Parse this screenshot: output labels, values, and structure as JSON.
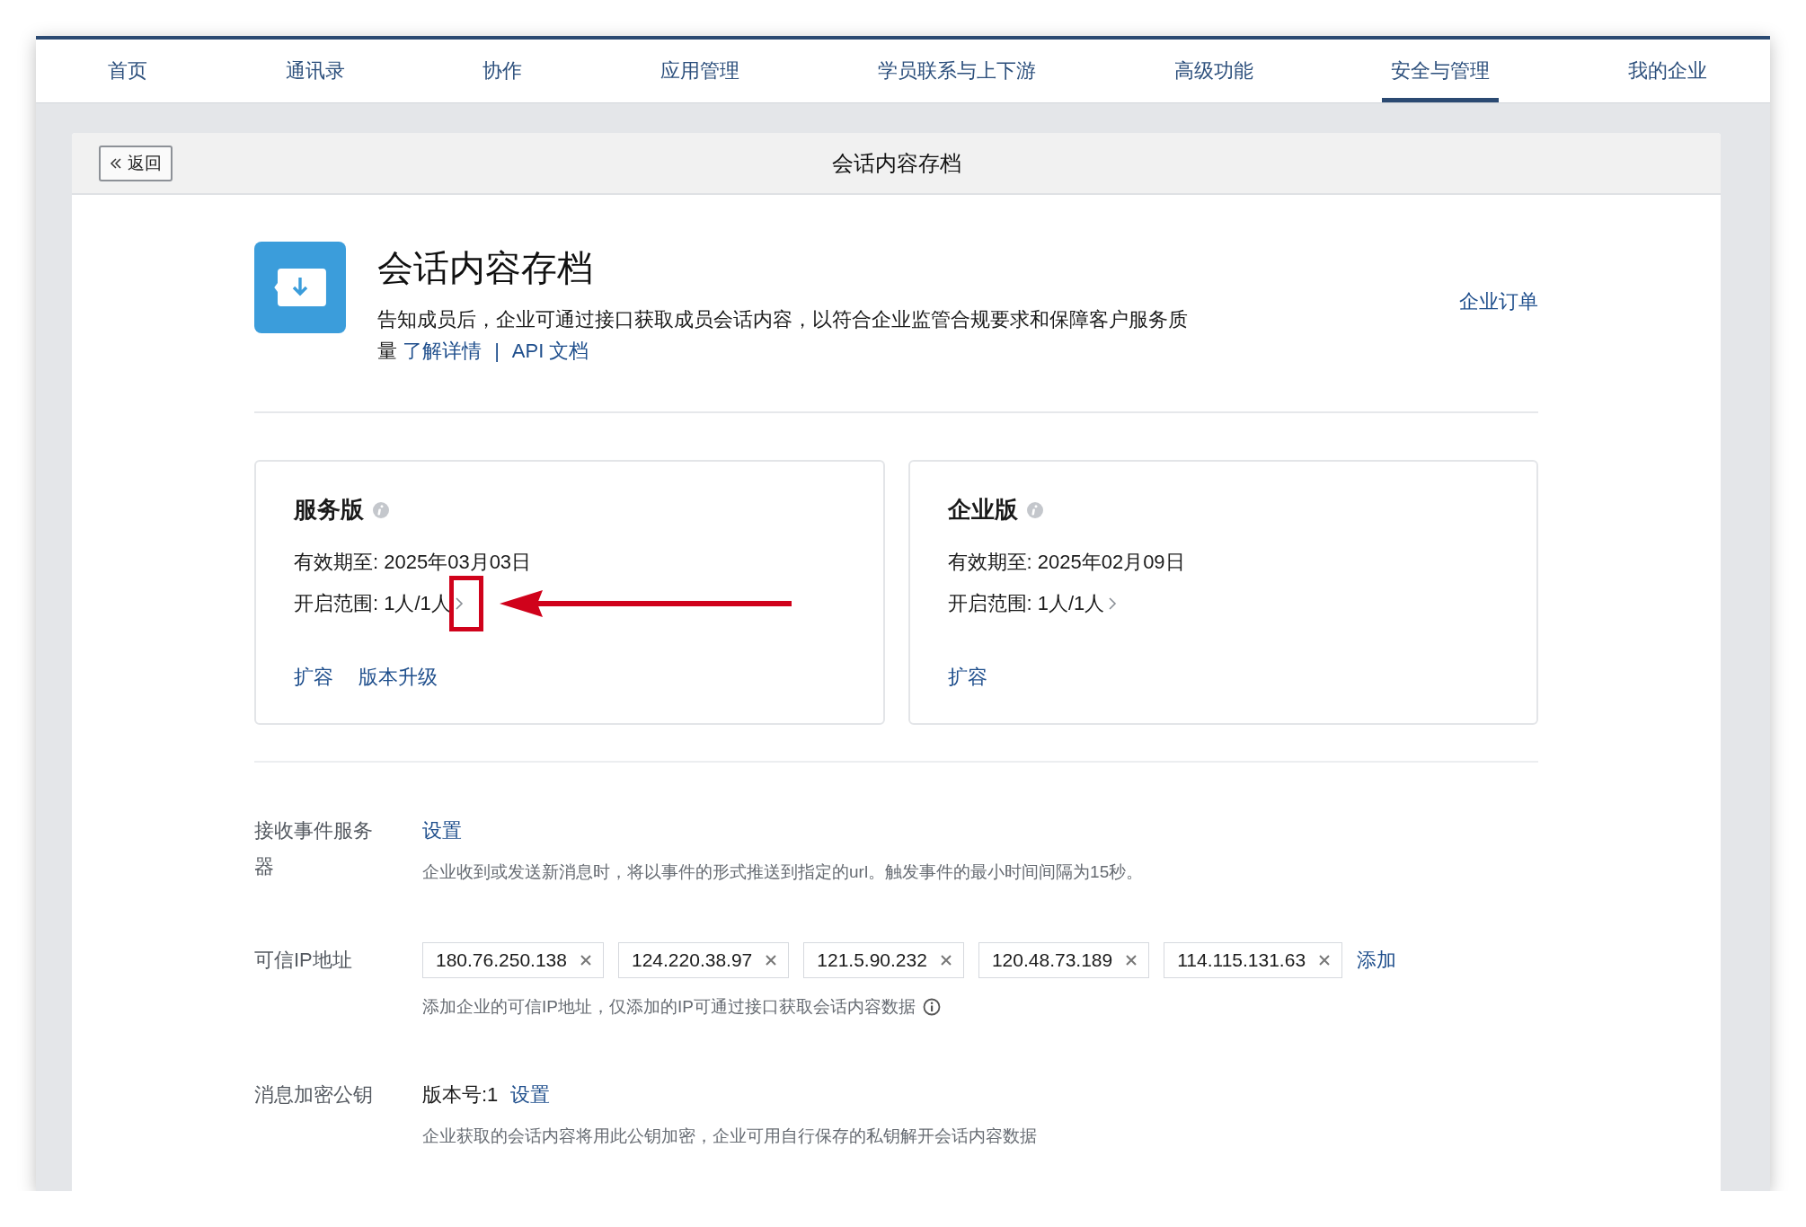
{
  "nav": {
    "tabs": [
      {
        "label": "首页",
        "selected": false
      },
      {
        "label": "通讯录",
        "selected": false
      },
      {
        "label": "协作",
        "selected": false
      },
      {
        "label": "应用管理",
        "selected": false
      },
      {
        "label": "学员联系与上下游",
        "selected": false
      },
      {
        "label": "高级功能",
        "selected": false
      },
      {
        "label": "安全与管理",
        "selected": true
      },
      {
        "label": "我的企业",
        "selected": false
      }
    ]
  },
  "header": {
    "back_button": "返回",
    "title": "会话内容存档"
  },
  "app": {
    "title": "会话内容存档",
    "description": "告知成员后，企业可通过接口获取成员会话内容，以符合企业监管合规要求和保障客户服务质量",
    "links": [
      "了解详情",
      "API 文档"
    ],
    "separator": "|",
    "order_link": "企业订单"
  },
  "editions": [
    {
      "name": "服务版",
      "expiry": "有效期至: 2025年03月03日",
      "scope": "开启范围: 1人/1人",
      "actions": [
        "扩容",
        "版本升级"
      ],
      "highlighted": true
    },
    {
      "name": "企业版",
      "expiry": "有效期至: 2025年02月09日",
      "scope": "开启范围: 1人/1人",
      "actions": [
        "扩容"
      ],
      "highlighted": false
    }
  ],
  "settings": {
    "event_server": {
      "label": "接收事件服务器",
      "link": "设置",
      "note": "企业收到或发送新消息时，将以事件的形式推送到指定的url。触发事件的最小时间间隔为15秒。"
    },
    "trusted_ip": {
      "label": "可信IP地址",
      "ips": [
        "180.76.250.138",
        "124.220.38.97",
        "121.5.90.232",
        "120.48.73.189",
        "114.115.131.63"
      ],
      "add_link": "添加",
      "note": "添加企业的可信IP地址，仅添加的IP可通过接口获取会话内容数据"
    },
    "encryption_key": {
      "label": "消息加密公钥",
      "version": "版本号:1",
      "link": "设置",
      "note": "企业获取的会话内容将用此公钥加密，企业可用自行保存的私钥解开会话内容数据"
    }
  }
}
